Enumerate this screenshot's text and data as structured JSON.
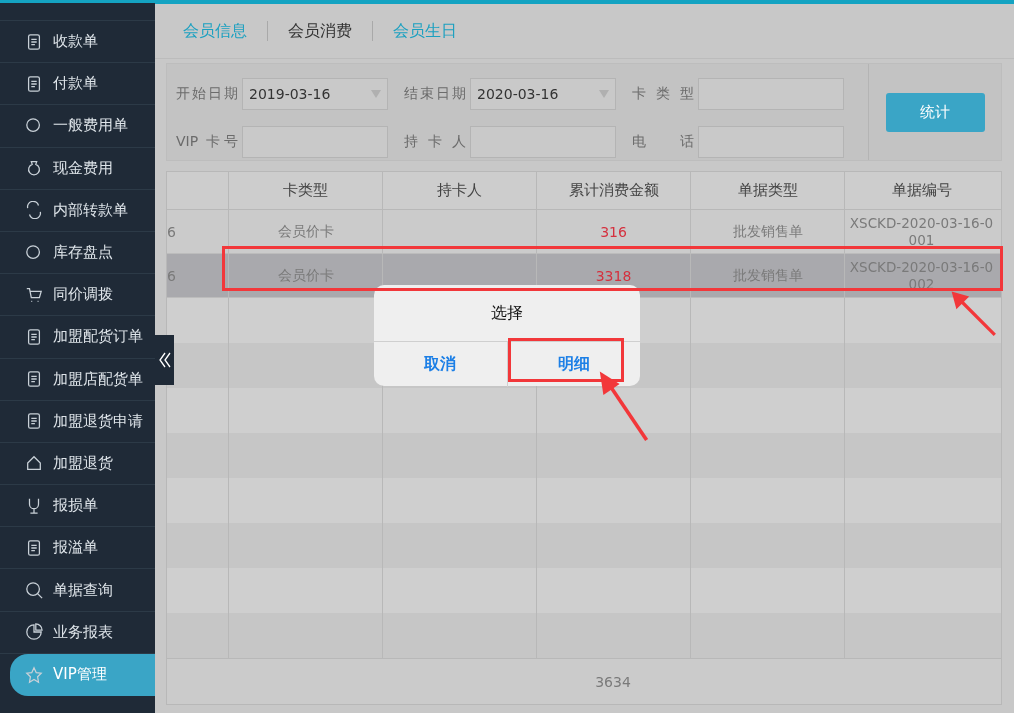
{
  "sidebar": {
    "items": [
      {
        "label": "收款单",
        "selected": false
      },
      {
        "label": "付款单",
        "selected": false
      },
      {
        "label": "一般费用单",
        "selected": false
      },
      {
        "label": "现金费用",
        "selected": false
      },
      {
        "label": "内部转款单",
        "selected": false
      },
      {
        "label": "库存盘点",
        "selected": false
      },
      {
        "label": "同价调拨",
        "selected": false
      },
      {
        "label": "加盟配货订单",
        "selected": false
      },
      {
        "label": "加盟店配货单",
        "selected": false
      },
      {
        "label": "加盟退货申请",
        "selected": false
      },
      {
        "label": "加盟退货",
        "selected": false
      },
      {
        "label": "报损单",
        "selected": false
      },
      {
        "label": "报溢单",
        "selected": false
      },
      {
        "label": "单据查询",
        "selected": false
      },
      {
        "label": "业务报表",
        "selected": false
      },
      {
        "label": "VIP管理",
        "selected": true
      }
    ]
  },
  "tabs": [
    {
      "label": "会员信息",
      "selected": false
    },
    {
      "label": "会员消费",
      "selected": true
    },
    {
      "label": "会员生日",
      "selected": false
    }
  ],
  "filters": [
    {
      "label": "开始日期",
      "kind": "date",
      "value": "2019-03-16"
    },
    {
      "label": "结束日期",
      "kind": "date",
      "value": "2020-03-16"
    },
    {
      "label": "卡 类 型",
      "kind": "text"
    },
    {
      "label": "VIP 卡号",
      "kind": "text"
    },
    {
      "label": "持 卡 人",
      "kind": "text"
    },
    {
      "label": "电 话",
      "kind": "text"
    }
  ],
  "stat_button": "统计",
  "table": {
    "columns": [
      "卡类型",
      "持卡人",
      "累计消费金额",
      "单据类型",
      "单据编号"
    ],
    "rows": [
      {
        "column_1": "6",
        "card_type": "会员价卡",
        "amount": "316",
        "doc_type": "批发销售单",
        "doc_no": "XSCKD-2020-03-16-0001",
        "selected": false
      },
      {
        "column_1": "6",
        "card_type": "会员价卡",
        "amount": "3318",
        "doc_type": "批发销售单",
        "doc_no": "XSCKD-2020-03-16-0002",
        "selected": true
      }
    ],
    "total": "3634"
  },
  "dialog": {
    "title": "选择",
    "buttons": [
      {
        "label": "取消",
        "highlighted": false
      },
      {
        "label": "明细",
        "highlighted": true
      }
    ]
  }
}
